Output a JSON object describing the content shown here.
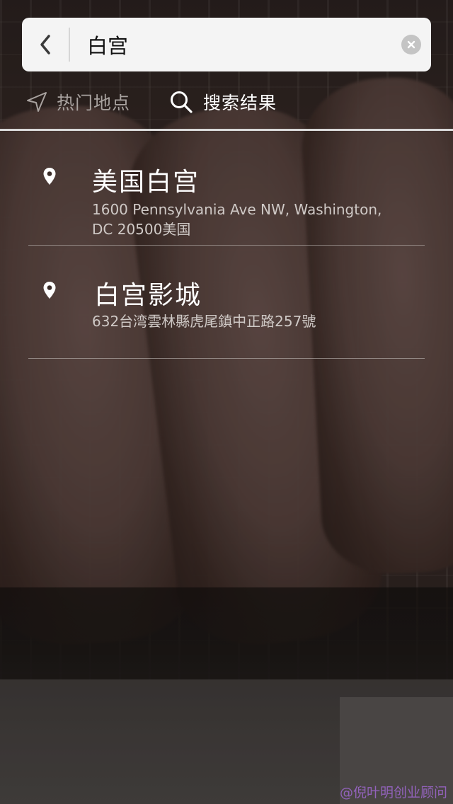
{
  "search": {
    "value": "白宫"
  },
  "tabs": [
    {
      "label": "热门地点",
      "icon": "navigation-arrow-icon",
      "active": false
    },
    {
      "label": "搜索结果",
      "icon": "search-icon",
      "active": true
    }
  ],
  "results": [
    {
      "title": "美国白宫",
      "address": "1600 Pennsylvania Ave NW, Washington, DC 20500美国",
      "icon": "map-pin-icon"
    },
    {
      "title": "白宫影城",
      "address": "632台湾雲林縣虎尾鎮中正路257號",
      "icon": "map-pin-icon"
    }
  ],
  "watermark": "@倪叶明创业顾问",
  "colors": {
    "search_bg": "#f4f4f4",
    "active_tab_text": "#ffffff",
    "inactive_tab_text": "#a8a29f",
    "clear_button": "#c4c4c4"
  }
}
